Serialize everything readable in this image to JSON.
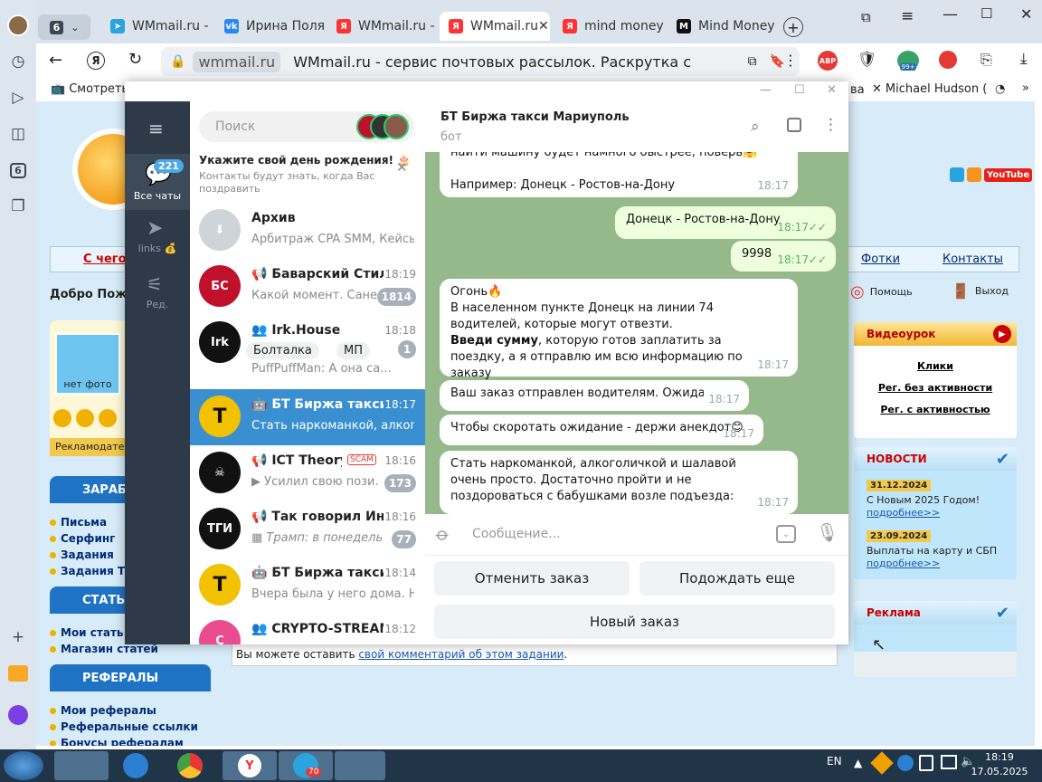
{
  "browser": {
    "tab_count": "6",
    "tabs": [
      {
        "label": "WMmail.ru - с",
        "icon": "telegram-icon",
        "color": "#2aa3de"
      },
      {
        "label": "Ирина Поляк",
        "icon": "vk-icon",
        "color": "#2787f5"
      },
      {
        "label": "WMmail.ru - с",
        "icon": "yandex-icon",
        "color": "#f33"
      },
      {
        "label": "WMmail.ru",
        "icon": "yandex-icon",
        "color": "#f33"
      },
      {
        "label": "mind money",
        "icon": "yandex-icon",
        "color": "#f33"
      },
      {
        "label": "Mind Money",
        "icon": "m-icon",
        "color": "#111"
      }
    ],
    "url_domain": "wmmail.ru",
    "page_title": "WMmail.ru - сервис почтовых рассылок. Раскрутка сайт...",
    "bookmarks": {
      "left": "Смотреть",
      "right1": "ва",
      "right2": "Michael Hudson ("
    },
    "ext_badge": "99+",
    "abp": "ABP"
  },
  "page": {
    "menu_left": "С чего н",
    "menu_items": [
      "Фотки",
      "Контакты"
    ],
    "welcome": "Добро Пожал",
    "help": "Помощь",
    "exit": "Выход",
    "no_photo": "нет фото",
    "adv_label": "Рекламодатель",
    "earn_title": "ЗАРАБО",
    "earn_items": [
      "Письма",
      "Серфинг",
      "Задания",
      "Задания Т"
    ],
    "articles_title": "СТАТЬИ",
    "articles_items": [
      "Мои стать",
      "Магазин статей"
    ],
    "ref_title": "РЕФЕРАЛЫ",
    "ref_items": [
      "Мои рефералы",
      "Реферальные ссылки",
      "Бонусы рефералам"
    ],
    "comment_prefix": "Вы можете оставить ",
    "comment_link": "свой комментарий об этом задании",
    "comment_suffix": ".",
    "video_title": "Видеоурок",
    "video_links": [
      "Клики",
      "Рег. без активности",
      "Рег. с активностью"
    ],
    "news_title": "НОВОСТИ",
    "news": [
      {
        "date": "31.12.2024",
        "text": "С Новым 2025 Годом!",
        "more": "подробнее>>"
      },
      {
        "date": "23.09.2024",
        "text": "Выплаты на карту и СБП",
        "more": "подробнее>>"
      }
    ],
    "ads_title": "Реклама",
    "youtube": "YouTube"
  },
  "telegram": {
    "search_placeholder": "Поиск",
    "all_chats_badge": "221",
    "rail": [
      {
        "label": "Все чаты"
      },
      {
        "label": "links 💰"
      },
      {
        "label": "Ред."
      }
    ],
    "birthday_title": "Укажите свой день рождения! 🎂",
    "birthday_text": "Контакты будут знать, когда Вас поздравить",
    "archive": {
      "name": "Архив",
      "preview": "Арбитраж CPA SMM, Кейсы ..."
    },
    "chats": [
      {
        "name": "Баварский Стиль...",
        "time": "18:19",
        "preview": "Какой момент. Сане ...",
        "badge": "1814",
        "color": "#c0102a",
        "initials": "БС"
      },
      {
        "name": "Irk.House",
        "time": "18:18",
        "preview": "PuffPuffMan: А она са...",
        "badge": "1",
        "color": "#111",
        "initials": "Irk",
        "tag1": "Болталка",
        "tag2": "МП"
      },
      {
        "name": "БТ Биржа такси ...",
        "time": "18:17",
        "preview": "Стать наркоманкой, алкого...",
        "badge": "",
        "color": "#f2c200",
        "initials": "T"
      },
      {
        "name": "ICT Theory [T...",
        "time": "18:16",
        "preview": "Усилил свою пози...",
        "badge": "173",
        "color": "#111",
        "initials": "☠",
        "scam": "SCAM"
      },
      {
        "name": "Так говорил Инве...",
        "time": "18:16",
        "preview": "Трамп: в понедельн...",
        "badge": "77",
        "color": "#111",
        "initials": "ТГИ"
      },
      {
        "name": "БТ Биржа такси А...",
        "time": "18:14",
        "preview": "Вчера была у него дома. На...",
        "badge": "",
        "color": "#f2c200",
        "initials": "T"
      },
      {
        "name": "CRYPTO-STREAMI...",
        "time": "18:12",
        "preview": "",
        "badge": "",
        "color": "#e94c8f",
        "initials": "C"
      }
    ],
    "header": {
      "title": "БТ Биржа такси Мариуполь",
      "subtitle": "бот"
    },
    "messages": [
      {
        "dir": "in",
        "text": "найти машину будет намного быстрее, поверь🤗",
        "time": ""
      },
      {
        "dir": "in",
        "text": "Например: Донецк - Ростов-на-Дону",
        "time": "18:17"
      },
      {
        "dir": "out",
        "text": "Донецк - Ростов-на-Дону",
        "time": "18:17"
      },
      {
        "dir": "out",
        "text": "9998",
        "time": "18:17"
      },
      {
        "dir": "in",
        "line1": "Огонь🔥",
        "line2": "В населенном пункте Донецк на линии 74  водителей, которые могут отвезти.",
        "line3_bold": "Введи сумму",
        "line3_rest": ", которую готов заплатить за поездку, а я отправлю им всю информацию по заказу",
        "time": "18:17"
      },
      {
        "dir": "in",
        "text": "Ваш заказ отправлен водителям. Ожидайте...",
        "time": "18:17"
      },
      {
        "dir": "in",
        "text": "Чтобы скоротать ожидание - держи анекдот😊",
        "time": "18:17"
      },
      {
        "dir": "in",
        "text": "Стать наркоманкой, алкоголичкой и шалавой очень просто. Достаточно пройти и не поздороваться с бабушками возле подъезда:",
        "time": "18:17"
      }
    ],
    "input_placeholder": "Сообщение...",
    "keyboard": [
      "Отменить заказ",
      "Подождать еще",
      "Новый заказ"
    ]
  },
  "taskbar": {
    "lang": "EN",
    "time": "18:19",
    "date": "17.05.2025",
    "tg_badge": "70"
  }
}
